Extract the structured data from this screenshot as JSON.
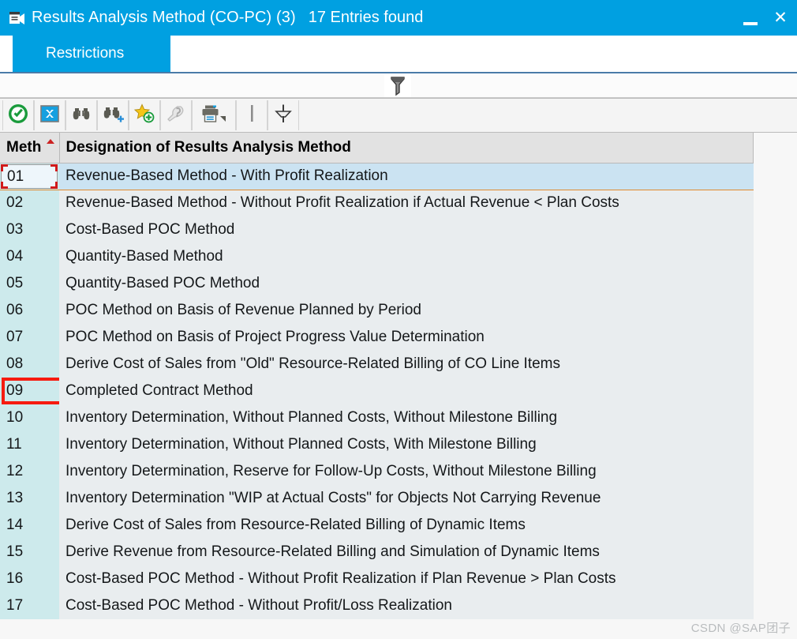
{
  "window": {
    "title": "Results Analysis Method (CO-PC) (3)",
    "entries_found": "17 Entries found",
    "title_icon": "selection-list-icon",
    "accent_color": "#00a0e1",
    "minimize_label": "_",
    "close_label": "✕"
  },
  "tabs": [
    {
      "label": "Restrictions",
      "active": true
    }
  ],
  "dragstrip": {
    "filter_icon": "funnel-icon"
  },
  "toolbar": {
    "buttons": [
      {
        "name": "copy-confirm-button",
        "icon": "green-check-icon",
        "title": "Copy"
      },
      {
        "name": "cancel-button",
        "icon": "blue-cancel-x-icon",
        "title": "Cancel"
      },
      {
        "name": "find-button",
        "icon": "binoculars-icon",
        "title": "Find"
      },
      {
        "name": "find-next-button",
        "icon": "binoculars-plus-icon",
        "title": "Find Next"
      },
      {
        "name": "add-favorite-button",
        "icon": "star-plus-icon",
        "title": "Create Favorite"
      },
      {
        "name": "personal-value-button",
        "icon": "question-tag-icon",
        "title": "Personal Value List",
        "disabled": true
      },
      {
        "name": "print-button",
        "icon": "printer-dropdown-icon",
        "title": "Print"
      },
      {
        "name": "separator-1",
        "icon": "vertical-separator-icon",
        "title": ""
      },
      {
        "name": "filter-button",
        "icon": "filter-funnel-icon",
        "title": "Set Filter"
      }
    ]
  },
  "table": {
    "columns": [
      {
        "key": "code",
        "label": "Meth",
        "sorted": true,
        "sort_direction": "ascending"
      },
      {
        "key": "desc",
        "label": "Designation of Results Analysis Method"
      }
    ],
    "selected_row_index": 0,
    "annotated_row_index": 8,
    "rows": [
      {
        "code": "01",
        "desc": "Revenue-Based Method - With Profit Realization"
      },
      {
        "code": "02",
        "desc": "Revenue-Based Method - Without Profit Realization if Actual Revenue < Plan Costs"
      },
      {
        "code": "03",
        "desc": "Cost-Based POC Method"
      },
      {
        "code": "04",
        "desc": "Quantity-Based Method"
      },
      {
        "code": "05",
        "desc": "Quantity-Based POC Method"
      },
      {
        "code": "06",
        "desc": "POC Method on Basis of Revenue Planned by Period"
      },
      {
        "code": "07",
        "desc": "POC Method on Basis of Project Progress Value Determination"
      },
      {
        "code": "08",
        "desc": "Derive Cost of Sales from \"Old\" Resource-Related Billing of CO Line Items"
      },
      {
        "code": "09",
        "desc": "Completed Contract Method"
      },
      {
        "code": "10",
        "desc": "Inventory Determination, Without Planned Costs, Without Milestone Billing"
      },
      {
        "code": "11",
        "desc": "Inventory Determination, Without Planned Costs, With Milestone Billing"
      },
      {
        "code": "12",
        "desc": "Inventory Determination, Reserve for Follow-Up Costs, Without Milestone Billing"
      },
      {
        "code": "13",
        "desc": "Inventory Determination \"WIP at Actual Costs\" for Objects Not Carrying Revenue"
      },
      {
        "code": "14",
        "desc": "Derive Cost of Sales from Resource-Related Billing of Dynamic Items"
      },
      {
        "code": "15",
        "desc": "Derive Revenue from Resource-Related Billing and Simulation of Dynamic Items"
      },
      {
        "code": "16",
        "desc": "Cost-Based POC Method - Without Profit Realization if Plan Revenue > Plan Costs"
      },
      {
        "code": "17",
        "desc": "Cost-Based POC Method - Without Profit/Loss Realization"
      }
    ]
  },
  "annotation": {
    "color": "#f61b10"
  },
  "watermark": {
    "text": "CSDN @SAP团子"
  }
}
